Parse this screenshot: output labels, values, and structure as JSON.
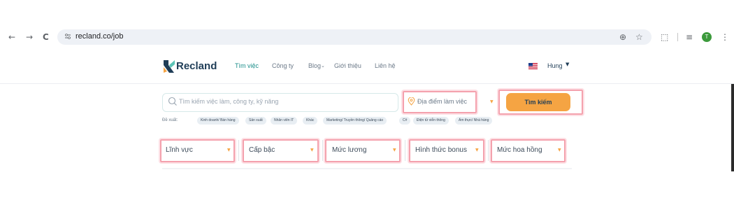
{
  "browser": {
    "url": "recland.co/job",
    "profile_initial": "T",
    "nav": {
      "back_icon": "←",
      "forward_icon": "→",
      "reload_icon": "C"
    },
    "icons": {
      "zoom_icon": "⊕",
      "star_icon": "☆",
      "extensions_icon": "⬚",
      "menu_icon": "⋮",
      "media_icon": "≡"
    }
  },
  "site": {
    "logo_text": "Recland",
    "nav": [
      {
        "label": "Tìm việc",
        "active": true
      },
      {
        "label": "Công ty"
      },
      {
        "label": "Blog"
      },
      {
        "label": "Giới thiệu"
      },
      {
        "label": "Liên hệ"
      }
    ],
    "blog_caret": "⌄",
    "user_name": "Hung",
    "user_caret": "▼"
  },
  "search": {
    "placeholder": "Tìm kiếm việc làm, công ty, kỹ năng",
    "location_placeholder": "Địa điểm làm việc",
    "button_label": "Tìm kiếm",
    "caret": "▼"
  },
  "suggestions": {
    "label": "Đề xuất:",
    "chips": [
      "Kinh doanh/ Bán hàng",
      "Sản xuất",
      "Nhân viên IT",
      "Khác",
      "Marketing/ Truyền thông/ Quảng cáo",
      "C#",
      "Điện tử viễn thông",
      "Ẩm thực/ Nhà hàng"
    ]
  },
  "filters": [
    {
      "label": "Lĩnh vực"
    },
    {
      "label": "Cấp bậc"
    },
    {
      "label": "Mức lương"
    },
    {
      "label": "Hình thức bonus"
    },
    {
      "label": "Mức hoa hồng"
    }
  ],
  "filter_caret": "▼",
  "colors": {
    "accent": "#f5a443",
    "brand_dark": "#1f3d57",
    "brand_teal": "#1b8e8a",
    "highlight": "#f4a1ad"
  }
}
